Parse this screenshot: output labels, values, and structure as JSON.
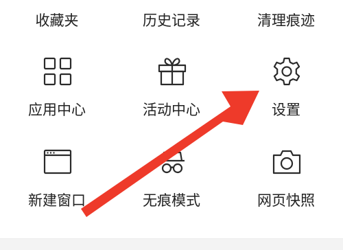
{
  "colors": {
    "icon_stroke": "#2a2a2a",
    "label_text": "#222222",
    "annotation_arrow": "#ee3a2a",
    "background": "#ffffff"
  },
  "menu": {
    "row0": [
      {
        "label": "收藏夹"
      },
      {
        "label": "历史记录"
      },
      {
        "label": "清理痕迹"
      }
    ],
    "row1": [
      {
        "label": "应用中心",
        "icon": "grid-apps-icon"
      },
      {
        "label": "活动中心",
        "icon": "gift-icon"
      },
      {
        "label": "设置",
        "icon": "gear-icon"
      }
    ],
    "row2": [
      {
        "label": "新建窗口",
        "icon": "browser-window-icon"
      },
      {
        "label": "无痕模式",
        "icon": "incognito-glasses-icon"
      },
      {
        "label": "网页快照",
        "icon": "camera-icon"
      }
    ]
  },
  "annotation": {
    "type": "arrow",
    "points_to": "设置"
  }
}
